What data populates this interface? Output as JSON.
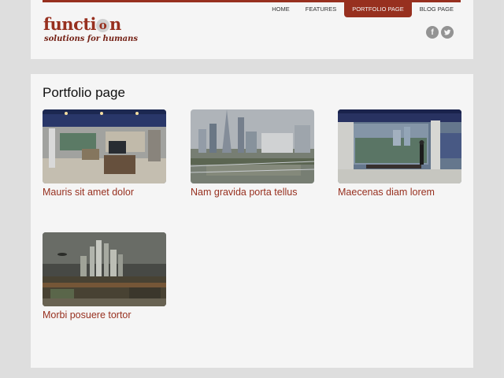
{
  "header": {
    "logo": {
      "word_start": "functi",
      "word_o": "o",
      "word_end": "n",
      "tagline": "solutions for humans"
    },
    "nav": [
      {
        "label": "HOME",
        "active": false
      },
      {
        "label": "FEATURES",
        "active": false
      },
      {
        "label": "PORTFOLIO PAGE",
        "active": true
      },
      {
        "label": "BLOG PAGE",
        "active": false
      }
    ],
    "social": [
      {
        "icon": "facebook-icon",
        "glyph": "f"
      },
      {
        "icon": "twitter-icon"
      }
    ]
  },
  "main": {
    "title": "Portfolio page",
    "items": [
      {
        "caption": "Mauris sit amet dolor",
        "image": "showroom-interior"
      },
      {
        "caption": "Nam gravida porta tellus",
        "image": "city-skyline"
      },
      {
        "caption": "Maecenas diam lorem",
        "image": "gallery-wall"
      },
      {
        "caption": "Morbi posuere tortor",
        "image": "futuristic-city"
      }
    ]
  },
  "colors": {
    "accent": "#9e3221",
    "background": "#e8e8e8",
    "panel": "#ffffff",
    "social": "#9a9a9a"
  }
}
